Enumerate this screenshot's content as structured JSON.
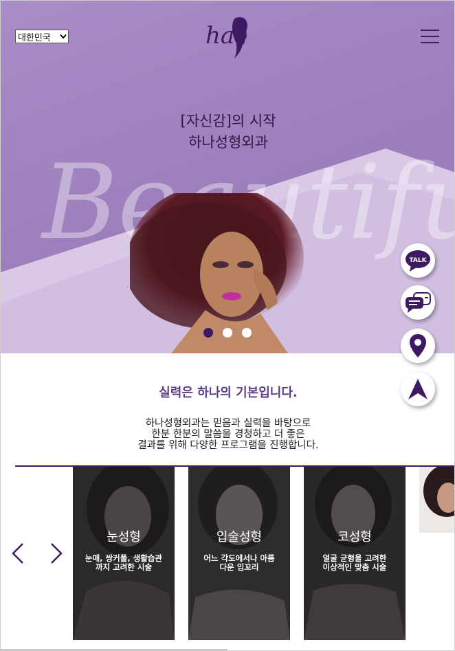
{
  "header": {
    "language_selected": "대한민국",
    "logo_text": "ha"
  },
  "hero": {
    "title_line1": "[자신감]의 시작",
    "title_line2": "하나성형외과",
    "watermark_text": "Beautiful",
    "slides": 3,
    "active_slide": 1
  },
  "floating_buttons": [
    {
      "name": "kakao-talk",
      "label": "TALK"
    },
    {
      "name": "chat"
    },
    {
      "name": "location"
    },
    {
      "name": "scroll-top"
    }
  ],
  "intro": {
    "heading": "실력은 하나의 기본입니다.",
    "line1": "하나성형외과는 믿음과 실력을 바탕으로",
    "line2": "한분 한분의 말씀을 경청하고 더 좋은",
    "line3": "결과를 위해 다양한 프로그램을 진행합니다."
  },
  "cards": [
    {
      "title": "눈성형",
      "desc1": "눈매, 쌍커풀, 생활습관",
      "desc2": "까지 고려한 시술"
    },
    {
      "title": "입술성형",
      "desc1": "어느 각도에서나 아름",
      "desc2": "다운 입꼬리"
    },
    {
      "title": "코성형",
      "desc1": "얼굴 균형을 고려한",
      "desc2": "이상적인 맞춤 시술"
    }
  ],
  "colors": {
    "brand_purple": "#3d1a63",
    "hero_bg": "#a98cc6",
    "heading_purple": "#5c3d8a"
  }
}
